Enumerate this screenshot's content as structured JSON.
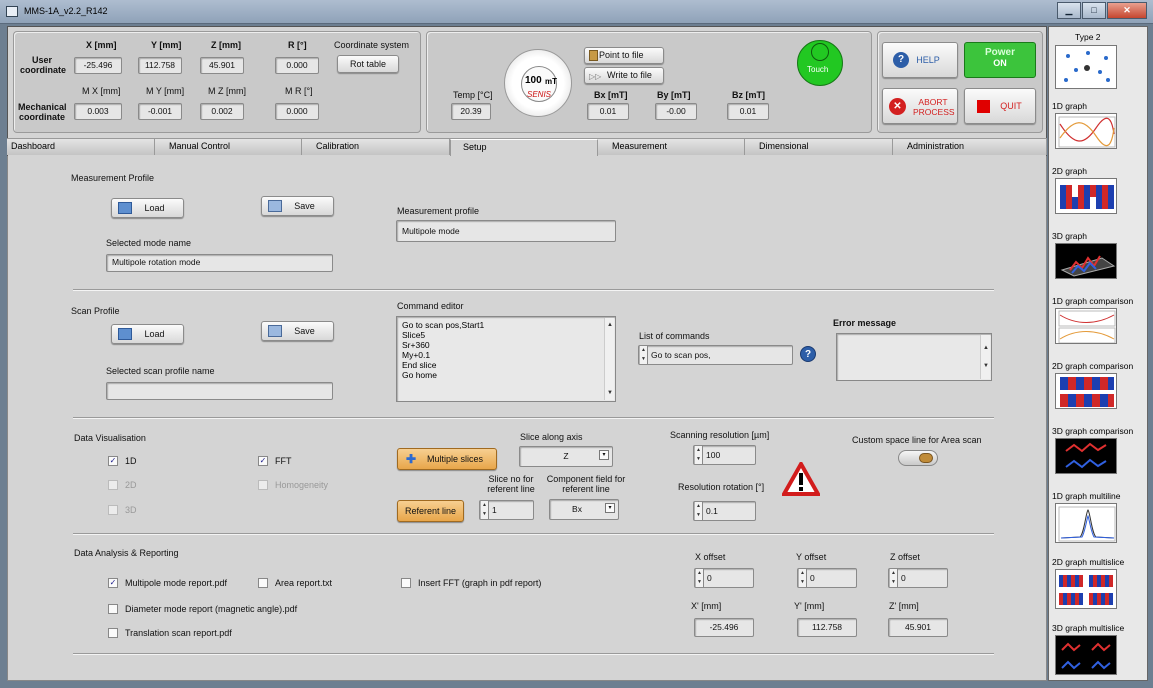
{
  "window": {
    "title": "MMS-1A_v2.2_R142"
  },
  "coords": {
    "headers": [
      "X [mm]",
      "Y [mm]",
      "Z [mm]",
      "R [°]"
    ],
    "user_label": "User coordinate",
    "user_values": [
      "-25.496",
      "112.758",
      "45.901",
      "0.000"
    ],
    "mech_headers": [
      "M X [mm]",
      "M Y [mm]",
      "M Z [mm]",
      "M R [°]"
    ],
    "mech_label": "Mechanical coordinate",
    "mech_values": [
      "0.003",
      "-0.001",
      "0.002",
      "0.000"
    ],
    "coord_system_label": "Coordinate system",
    "coord_system_value": "Rot table"
  },
  "sensor": {
    "temp_label": "Temp [°C]",
    "temp_value": "20.39",
    "gauge_value": "100",
    "gauge_unit": "mT",
    "gauge_brand": "SENIS",
    "point_to_file": "Point to file",
    "write_to_file": "Write to file",
    "bx_label": "Bx [mT]",
    "bx_value": "0.01",
    "by_label": "By [mT]",
    "by_value": "-0.00",
    "bz_label": "Bz [mT]",
    "bz_value": "0.01",
    "touch_label": "Touch"
  },
  "controls": {
    "help": "HELP",
    "power_title": "Power",
    "power_state": "ON",
    "abort": "ABORT PROCESS",
    "quit": "QUIT"
  },
  "tabs": [
    "Dashboard",
    "Manual Control",
    "Calibration",
    "Setup",
    "Measurement",
    "Dimensional",
    "Administration"
  ],
  "setup": {
    "measurement_profile": {
      "title": "Measurement Profile",
      "load": "Load",
      "save": "Save",
      "selected_mode_label": "Selected mode name",
      "selected_mode_value": "Multipole rotation mode",
      "profile_label": "Measurement profile",
      "profile_value": "Multipole mode"
    },
    "scan_profile": {
      "title": "Scan Profile",
      "load": "Load",
      "save": "Save",
      "selected_label": "Selected scan profile name",
      "selected_value": "",
      "command_editor_label": "Command editor",
      "commands": [
        "Go to scan pos,Start1",
        "Slice5",
        "Sr+360",
        "My+0.1",
        "End slice",
        "Go home"
      ],
      "list_label": "List of commands",
      "list_value": "Go to scan pos,",
      "error_label": "Error message"
    },
    "visualisation": {
      "title": "Data Visualisation",
      "items": [
        {
          "label": "1D",
          "checked": true,
          "enabled": true
        },
        {
          "label": "2D",
          "checked": false,
          "enabled": false
        },
        {
          "label": "3D",
          "checked": false,
          "enabled": false
        },
        {
          "label": "FFT",
          "checked": true,
          "enabled": true
        },
        {
          "label": "Homogeneity",
          "checked": false,
          "enabled": false
        }
      ],
      "multiple_slices": "Multiple slices",
      "slice_axis_label": "Slice along axis",
      "slice_axis_value": "Z",
      "referent_line": "Referent line",
      "slice_no_label": "Slice no for referent line",
      "slice_no_value": "1",
      "component_label": "Component field for referent line",
      "component_value": "Bx",
      "scan_res_label": "Scanning resolution [µm]",
      "scan_res_value": "100",
      "res_rot_label": "Resolution rotation [°]",
      "res_rot_value": "0.1",
      "custom_space_label": "Custom space line for Area scan"
    },
    "analysis": {
      "title": "Data Analysis & Reporting",
      "reports": [
        {
          "label": "Multipole mode report.pdf",
          "checked": true
        },
        {
          "label": "Area report.txt",
          "checked": false
        },
        {
          "label": "Insert FFT (graph in pdf report)",
          "checked": false
        },
        {
          "label": "Diameter mode report (magnetic angle).pdf",
          "checked": false
        },
        {
          "label": "Translation scan report.pdf",
          "checked": false
        }
      ],
      "x_offset_label": "X offset",
      "x_offset": "0",
      "y_offset_label": "Y offset",
      "y_offset": "0",
      "z_offset_label": "Z offset",
      "z_offset": "0",
      "x_mm_label": "X' [mm]",
      "x_mm": "-25.496",
      "y_mm_label": "Y' [mm]",
      "y_mm": "112.758",
      "z_mm_label": "Z' [mm]",
      "z_mm": "45.901"
    }
  },
  "sidebar": {
    "title": "Type 2",
    "items": [
      "1D graph",
      "2D graph",
      "3D graph",
      "1D graph comparison",
      "2D graph comparison",
      "3D graph comparison",
      "1D graph multiline",
      "2D graph multislice",
      "3D graph multislice"
    ]
  },
  "colors": {
    "power_green": "#3cc43c",
    "touch_green": "#22c822",
    "abort_red": "#d32020",
    "accent_blue": "#2d5ea8"
  }
}
